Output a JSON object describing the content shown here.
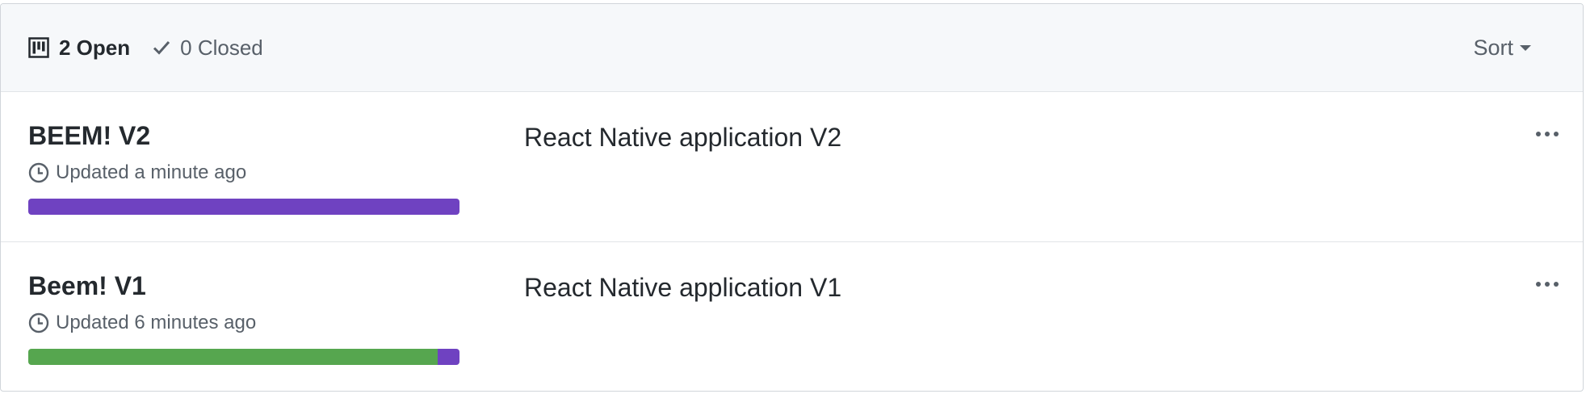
{
  "header": {
    "open_label": "2 Open",
    "closed_label": "0 Closed",
    "sort_label": "Sort"
  },
  "projects": [
    {
      "name": "BEEM! V2",
      "updated": "Updated a minute ago",
      "description": "React Native application V2",
      "progress": {
        "done": 0.0,
        "in_progress": 1.0
      }
    },
    {
      "name": "Beem! V1",
      "updated": "Updated 6 minutes ago",
      "description": "React Native application V1",
      "progress": {
        "done": 0.95,
        "in_progress": 0.05
      }
    }
  ],
  "colors": {
    "done": "#56a64f",
    "in_progress": "#6f42c1",
    "header_bg": "#f6f8fa",
    "border": "#d1d5da"
  },
  "icons": {
    "open": "project-icon",
    "closed": "check-icon",
    "updated": "clock-icon",
    "more": "kebab-horizontal-icon"
  }
}
